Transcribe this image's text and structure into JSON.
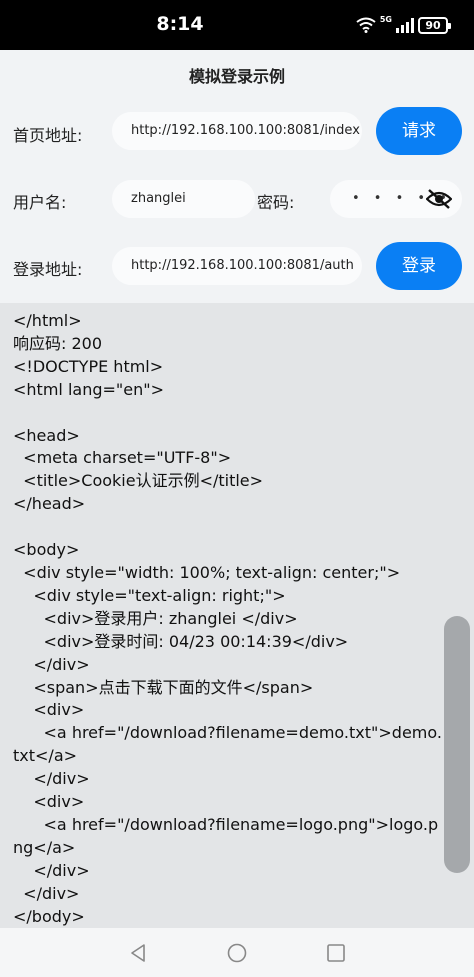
{
  "status_bar": {
    "time": "8:14",
    "network": "5G",
    "battery": "90"
  },
  "header": {
    "title": "模拟登录示例"
  },
  "form": {
    "home_label": "首页地址:",
    "home_url": "http://192.168.100.100:8081/index",
    "request_button": "请求",
    "username_label": "用户名:",
    "username_value": "zhanglei",
    "password_label": "密码:",
    "password_masked": "• • • • • •",
    "login_url_label": "登录地址:",
    "login_url": "http://192.168.100.100:8081/auth",
    "login_button": "登录"
  },
  "response": {
    "content": "</html>\n响应码: 200\n<!DOCTYPE html>\n<html lang=\"en\">\n\n<head>\n  <meta charset=\"UTF-8\">\n  <title>Cookie认证示例</title>\n</head>\n\n<body>\n  <div style=\"width: 100%; text-align: center;\">\n    <div style=\"text-align: right;\">\n      <div>登录用户: zhanglei </div>\n      <div>登录时间: 04/23 00:14:39</div>\n    </div>\n    <span>点击下载下面的文件</span>\n    <div>\n      <a href=\"/download?filename=demo.txt\">demo.txt</a>\n    </div>\n    <div>\n      <a href=\"/download?filename=logo.png\">logo.png</a>\n    </div>\n  </div>\n</body>"
  },
  "nav_bar": {
    "icons": [
      "back-icon",
      "home-icon",
      "recent-apps-icon"
    ]
  },
  "colors": {
    "accent": "#0a7ff4",
    "background": "#f1f3f5",
    "response_bg": "#e3e5e7"
  }
}
